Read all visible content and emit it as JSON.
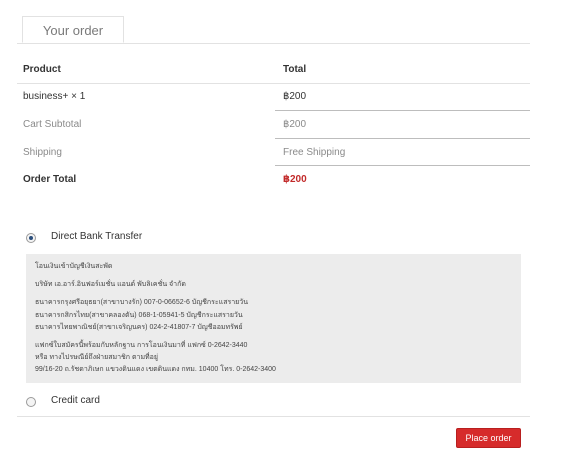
{
  "tab": {
    "label": "Your order"
  },
  "table": {
    "header": {
      "product": "Product",
      "total": "Total"
    },
    "item": {
      "name": "business+ × 1",
      "total": "฿200"
    },
    "subtotal": {
      "label": "Cart Subtotal",
      "value": "฿200"
    },
    "shipping": {
      "label": "Shipping",
      "value": "Free Shipping"
    },
    "order_total": {
      "label": "Order Total",
      "value": "฿200"
    }
  },
  "payment": {
    "bank": {
      "label": "Direct Bank Transfer",
      "selected": true,
      "instructions": [
        "โอนเงินเข้าบัญชีเงินสะพัด",
        "บริษัท เอ.อาร์.อินฟอร์เมชั่น แอนด์ พับลิเคชั่น จำกัด",
        "ธนาคารกรุงศรีอยุธยา(สาขาบางรัก) 007-0-06652-6 บัญชีกระแสรายวัน",
        "ธนาคารกสิกรไทย(สาขาคลองตัน) 068-1-05941-5 บัญชีกระแสรายวัน",
        "ธนาคารไทยพาณิชย์(สาขาเจริญนคร) 024-2-41807-7 บัญชีออมทรัพย์",
        "แฟกซ์ใบสมัครนี้พร้อมกับหลักฐาน การโอนเงินมาที่ แฟกซ์ 0-2642-3440",
        "หรือ ทางไปรษณีย์ถึงฝ่ายสมาชิก ตามที่อยู่",
        "99/16-20 ถ.รัชดาภิเษก แขวงดินแดง เขตดินแดง กทม. 10400 โทร. 0-2642-3400"
      ]
    },
    "card": {
      "label": "Credit card",
      "selected": false
    }
  },
  "place_order": {
    "label": "Place order"
  },
  "colors": {
    "accent": "#d62b2b",
    "price": "#c22a2a",
    "panel": "#ececec"
  }
}
